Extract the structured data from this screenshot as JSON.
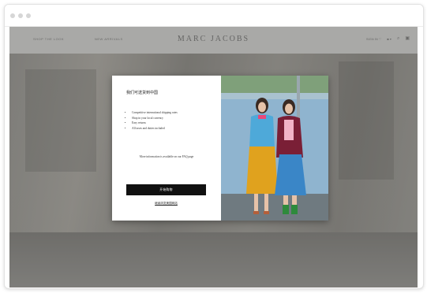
{
  "site": {
    "nav_left": [
      "SHOP THE LOOK",
      "NEW ARRIVALS"
    ],
    "logo": "MARC JACOBS",
    "nav_right": {
      "currency": "SIGN IN ♡",
      "flag": "■ ▾",
      "search_icon": "⌕",
      "bag_icon": "▣"
    }
  },
  "modal": {
    "title": "我们可送货到中国",
    "benefits": [
      "Competitive international shipping rates",
      "Shop in your local currency",
      "Easy returns",
      "All taxes and duties included"
    ],
    "info": "More information is available on our FAQ page",
    "cta_label": "开始购物",
    "alt_link": "继续浏览美国网站"
  },
  "colors": {
    "cta_background": "#111111",
    "photo_wall": "#8fb4cf",
    "overlay": "#5a5a58"
  }
}
